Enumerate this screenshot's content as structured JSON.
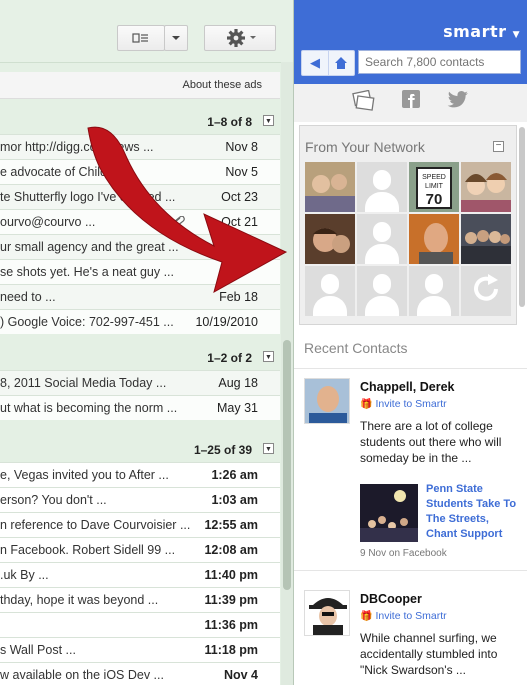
{
  "gmail": {
    "ads_link": "About these ads",
    "sections": [
      {
        "count": "1–8 of 8",
        "rows": [
          {
            "snippet": "mor http://digg.com/news ...",
            "date": "Nov 8",
            "unread": false
          },
          {
            "snippet": "e advocate of Child ...",
            "date": "Nov 5",
            "unread": false
          },
          {
            "snippet": "te Shutterfly logo I've created ...",
            "date": "Oct 23",
            "unread": false
          },
          {
            "snippet": "ourvo@courvo ...",
            "date": "Oct 21",
            "unread": false
          },
          {
            "snippet": "ur small agency and the great ...",
            "date": "Oct 20",
            "unread": false
          },
          {
            "snippet": "se shots yet. He's a neat guy ...",
            "date": "",
            "unread": false
          },
          {
            "snippet": "need to ...",
            "date": "Feb 18",
            "unread": false
          },
          {
            "snippet": ") Google Voice: 702-997-451 ...",
            "date": "10/19/2010",
            "unread": false
          }
        ]
      },
      {
        "count": "1–2 of 2",
        "rows": [
          {
            "snippet": "8, 2011 Social Media Today ...",
            "date": "Aug 18",
            "unread": false
          },
          {
            "snippet": "ut what is becoming the norm ...",
            "date": "May 31",
            "unread": false
          }
        ]
      },
      {
        "count": "1–25 of 39",
        "rows": [
          {
            "snippet": "e, Vegas invited you to After ...",
            "date": "1:26 am",
            "unread": true
          },
          {
            "snippet": "erson? You don't ...",
            "date": "1:03 am",
            "unread": true
          },
          {
            "snippet": "n reference to Dave Courvoisier ...",
            "date": "12:55 am",
            "unread": true
          },
          {
            "snippet": "n Facebook. Robert Sidell 99 ...",
            "date": "12:08 am",
            "unread": true
          },
          {
            "snippet": ".uk By ...",
            "date": "11:40 pm",
            "unread": true
          },
          {
            "snippet": "thday, hope it was beyond ...",
            "date": "11:39 pm",
            "unread": true
          },
          {
            "snippet": "",
            "date": "11:36 pm",
            "unread": true
          },
          {
            "snippet": "s Wall Post ...",
            "date": "11:18 pm",
            "unread": true
          },
          {
            "snippet": "w available on the iOS Dev ...",
            "date": "Nov 4",
            "unread": true
          }
        ]
      }
    ]
  },
  "smartr": {
    "brand": "smartr",
    "search_placeholder": "Search 7,800 contacts",
    "network_title": "From Your Network",
    "recent_title": "Recent Contacts",
    "contacts": [
      {
        "name": "Chappell, Derek",
        "invite": "Invite to Smartr",
        "text": "There are a lot of college students out there who will someday be in the ...",
        "story_title": "Penn State Students Take To The Streets, Chant Support",
        "meta": "9 Nov on Facebook"
      },
      {
        "name": "DBCooper",
        "invite": "Invite to Smartr",
        "text": "While channel surfing, we accidentally stumbled into \"Nick Swardson's ..."
      }
    ]
  },
  "icons": [
    "view-icon",
    "chevron-down-icon",
    "gear-icon",
    "back-icon",
    "home-icon",
    "contacts-card-icon",
    "facebook-icon",
    "twitter-icon",
    "refresh-icon",
    "gift-icon"
  ],
  "colors": {
    "smartr_blue": "#3e6dd6",
    "gmail_green": "#e4f0e4",
    "arrow_red": "#c0141b"
  }
}
